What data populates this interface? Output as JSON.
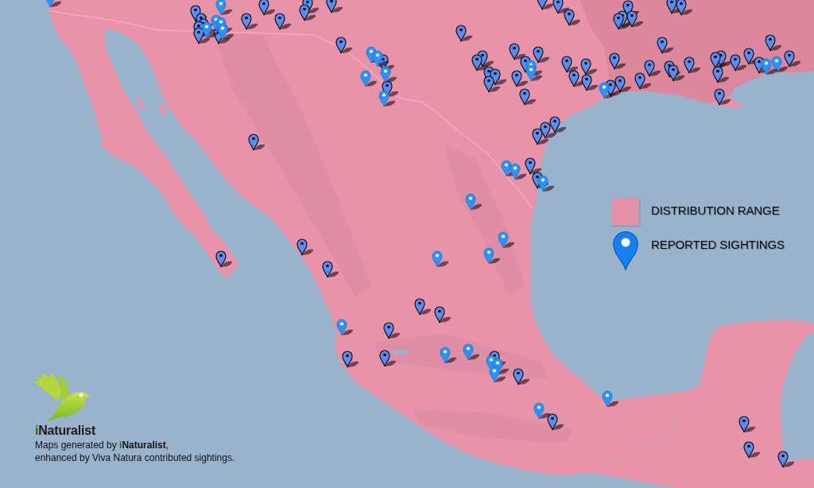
{
  "legend": [
    {
      "kind": "swatch",
      "label": "DISTRIBUTION RANGE"
    },
    {
      "kind": "pin",
      "label": "REPORTED SIGHTINGS"
    }
  ],
  "credit": {
    "logo": "iNaturalist",
    "lines": [
      "Maps generated by **iNaturalist**,",
      "enhanced by Viva Natura contributed sightings."
    ]
  }
}
